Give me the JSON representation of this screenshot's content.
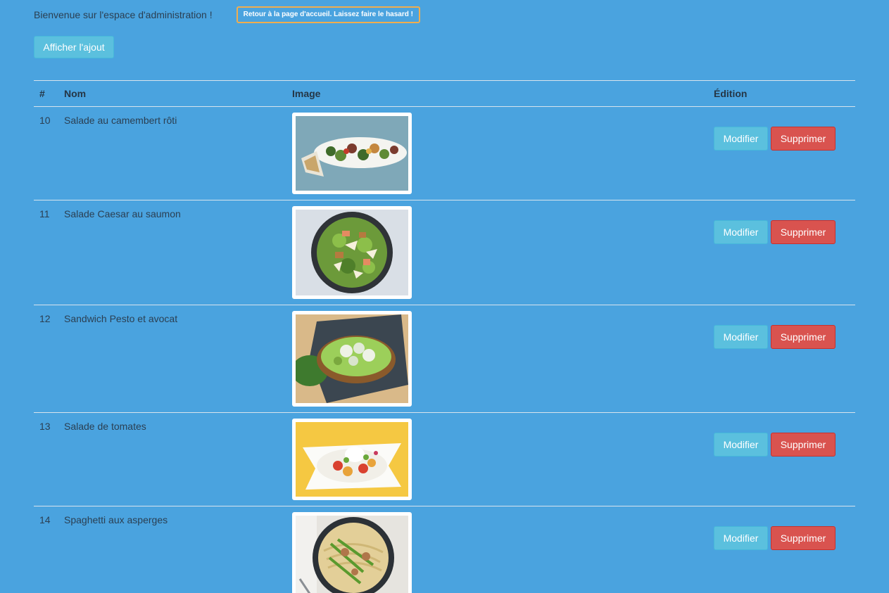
{
  "header": {
    "welcome": "Bienvenue sur l'espace d'administration !",
    "home_link": "Retour à la page d'accueil. Laissez faire le hasard !"
  },
  "toolbar": {
    "add_label": "Afficher l'ajout"
  },
  "table": {
    "columns": {
      "num": "#",
      "name": "Nom",
      "image": "Image",
      "edit": "Édition"
    },
    "actions": {
      "edit_label": "Modifier",
      "delete_label": "Supprimer"
    },
    "rows": [
      {
        "id": "10",
        "name": "Salade au camembert rôti"
      },
      {
        "id": "11",
        "name": "Salade Caesar au saumon"
      },
      {
        "id": "12",
        "name": "Sandwich Pesto et avocat"
      },
      {
        "id": "13",
        "name": "Salade de tomates"
      },
      {
        "id": "14",
        "name": "Spaghetti aux asperges"
      }
    ]
  },
  "colors": {
    "background": "#4aa3df",
    "info_button": "#5bc0de",
    "danger_button": "#d9534f",
    "warning_border": "#f0ad4e"
  }
}
